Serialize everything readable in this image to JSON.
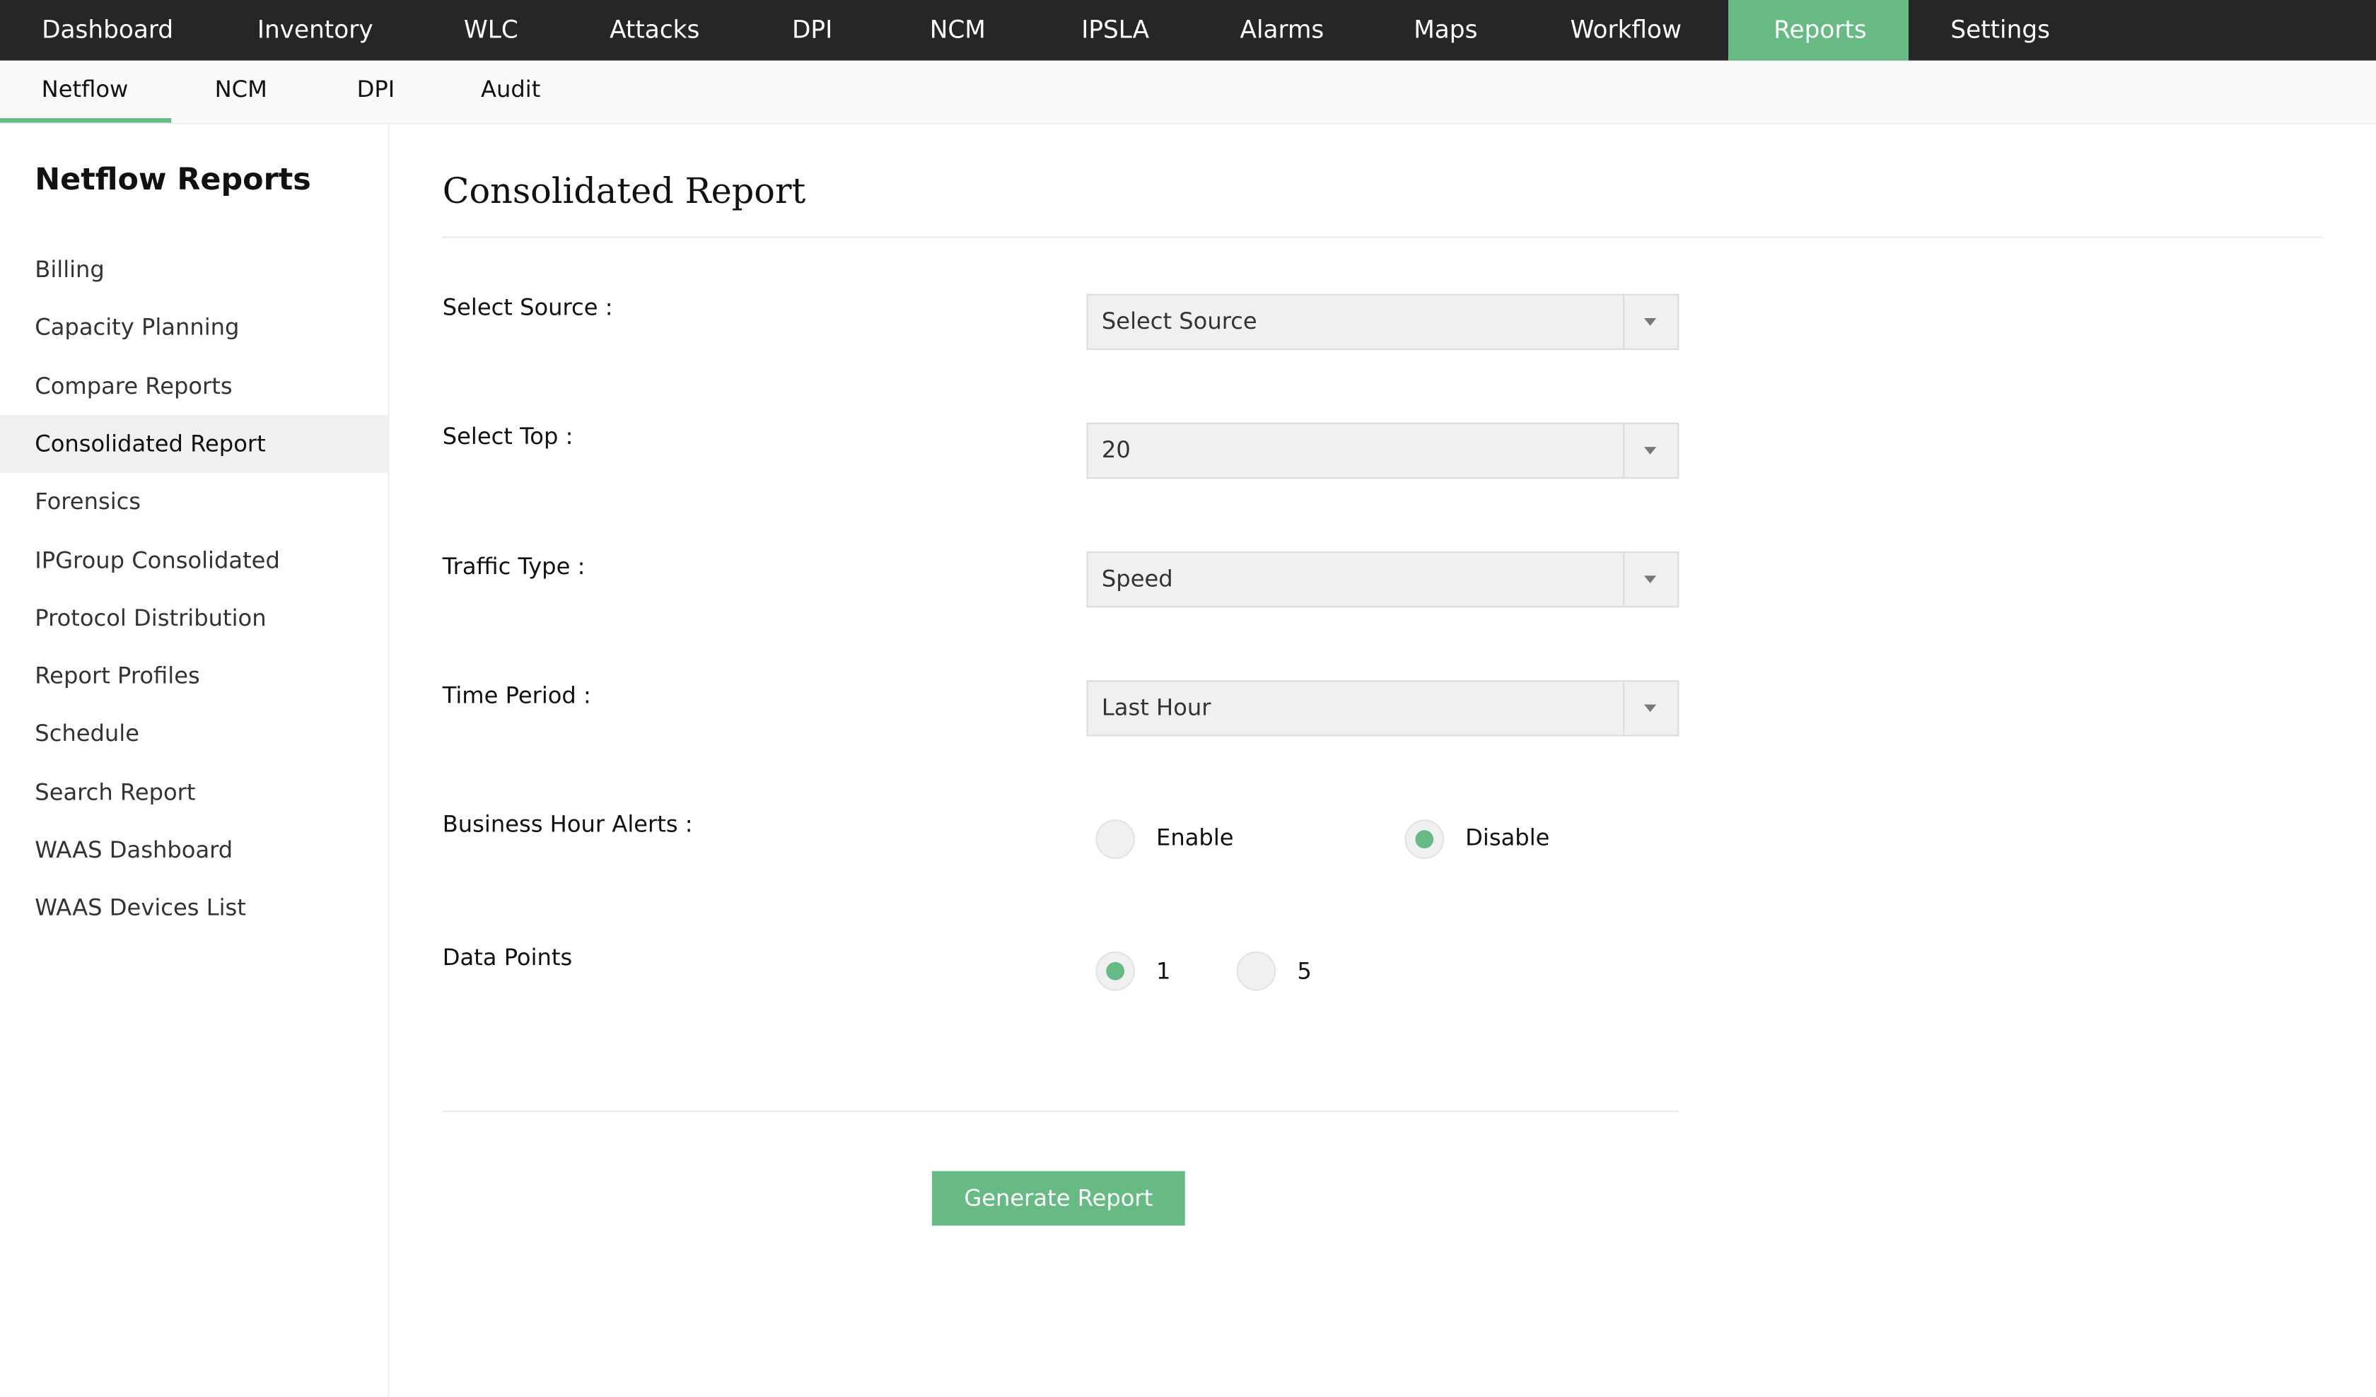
{
  "top_nav": {
    "items": [
      "Dashboard",
      "Inventory",
      "WLC",
      "Attacks",
      "DPI",
      "NCM",
      "IPSLA",
      "Alarms",
      "Maps",
      "Workflow",
      "Reports",
      "Settings"
    ],
    "active": "Reports"
  },
  "sub_nav": {
    "items": [
      "Netflow",
      "NCM",
      "DPI",
      "Audit"
    ],
    "active": "Netflow"
  },
  "sidebar": {
    "title": "Netflow Reports",
    "items": [
      "Billing",
      "Capacity Planning",
      "Compare Reports",
      "Consolidated Report",
      "Forensics",
      "IPGroup Consolidated",
      "Protocol Distribution",
      "Report Profiles",
      "Schedule",
      "Search Report",
      "WAAS Dashboard",
      "WAAS Devices List"
    ],
    "active": "Consolidated Report"
  },
  "main": {
    "title": "Consolidated Report",
    "fields": {
      "source": {
        "label": "Select Source :",
        "value": "Select Source"
      },
      "top": {
        "label": "Select Top :",
        "value": "20"
      },
      "traffic": {
        "label": "Traffic Type :",
        "value": "Speed"
      },
      "period": {
        "label": "Time Period :",
        "value": "Last Hour"
      }
    },
    "business_hour_alerts": {
      "label": "Business Hour Alerts :",
      "options": [
        "Enable",
        "Disable"
      ],
      "selected": "Disable"
    },
    "data_points": {
      "label": "Data Points",
      "options": [
        "1",
        "5"
      ],
      "selected": "1"
    },
    "generate_label": "Generate Report"
  },
  "colors": {
    "accent": "#67ba84",
    "topbar": "#262626"
  }
}
